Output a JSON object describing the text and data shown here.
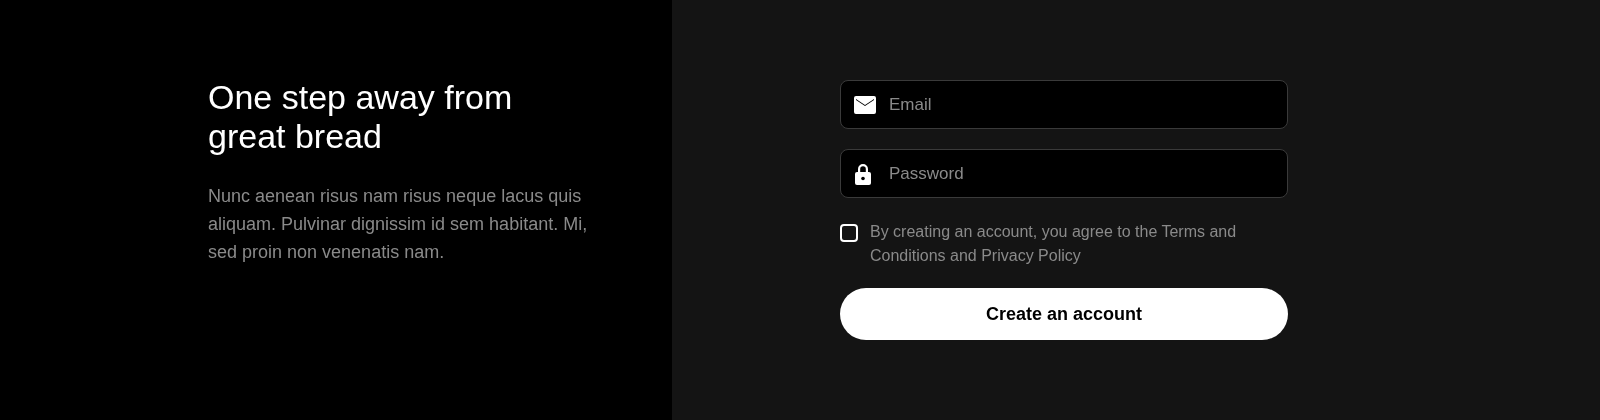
{
  "intro": {
    "title": "One step away from great bread",
    "text": "Nunc aenean risus nam risus neque lacus quis aliquam. Pulvinar dignissim id sem habitant. Mi, sed proin non venenatis nam."
  },
  "form": {
    "fields": [
      {
        "kind": "email",
        "placeholder": "Email"
      },
      {
        "kind": "password",
        "placeholder": "Password"
      }
    ],
    "terms": {
      "checked": false,
      "label": "By creating an account, you agree to the Terms and Conditions and Privacy Policy"
    },
    "submit": "Create an account"
  }
}
